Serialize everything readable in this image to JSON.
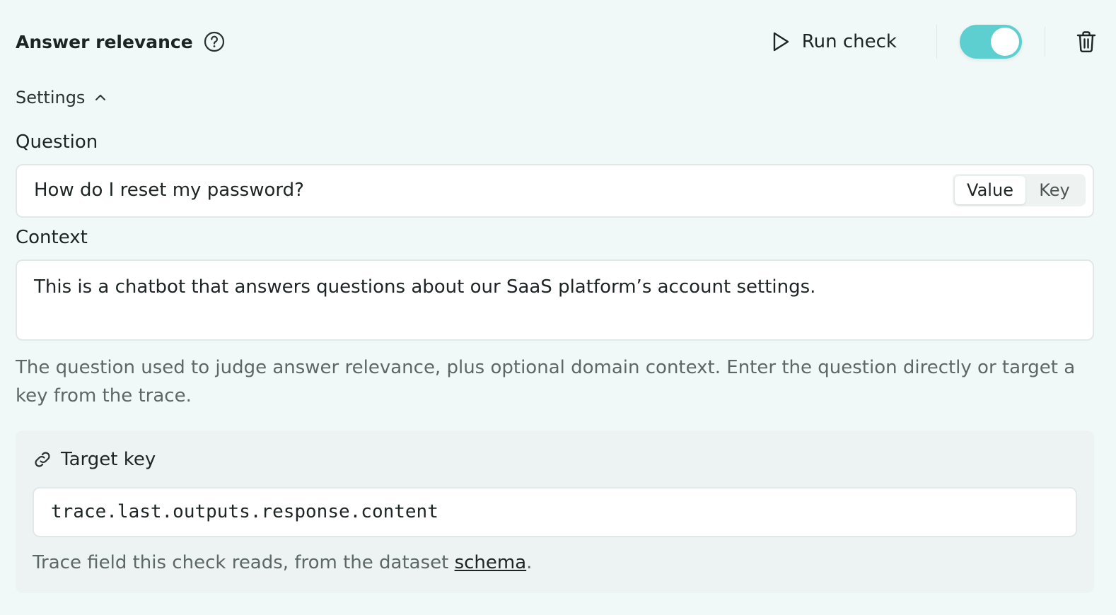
{
  "header": {
    "title": "Answer relevance",
    "help_icon": "help-circle-icon",
    "run_label": "Run check",
    "run_icon": "play-icon",
    "toggle_on": true,
    "toggle_color": "#5dcfd0",
    "delete_icon": "trash-icon"
  },
  "settings": {
    "label": "Settings",
    "icon": "chevron-up-icon",
    "expanded": true
  },
  "question": {
    "label": "Question",
    "value": "How do I reset my password?",
    "mode_options": [
      "Value",
      "Key"
    ],
    "selected_mode": "Value"
  },
  "context": {
    "label": "Context",
    "value": "This is a chatbot that answers questions about our SaaS platform’s account settings."
  },
  "help_text": "The question used to judge answer relevance, plus optional domain context. Enter the question directly or target a key from the trace.",
  "target": {
    "icon": "link-icon",
    "label": "Target key",
    "value": "trace.last.outputs.response.content",
    "note_prefix": "Trace field this check reads, from the dataset ",
    "note_link": "schema",
    "note_suffix": "."
  }
}
